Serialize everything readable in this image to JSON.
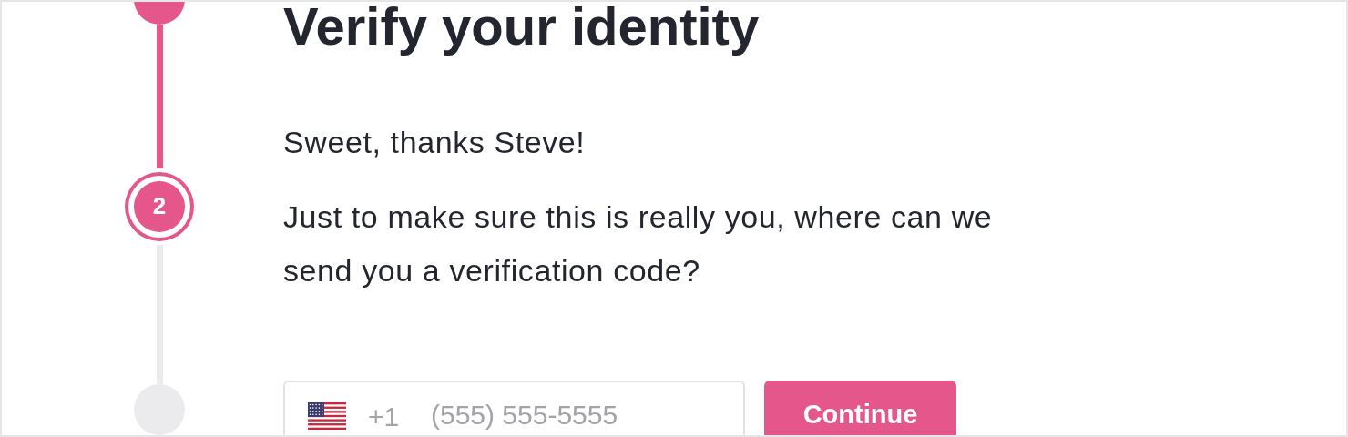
{
  "steps": [
    {
      "completed": true,
      "selected": false
    },
    {
      "number": "2",
      "completed": false,
      "selected": true
    },
    {
      "completed": false,
      "selected": false
    }
  ],
  "heading": "Verify your identity",
  "paragraphs": [
    "Sweet, thanks Steve!",
    "Just to make sure this is really you, where can we send you a verification code?"
  ],
  "phone": {
    "country_code": "+1",
    "placeholder": "(555) 555-5555"
  },
  "button": "Continue"
}
